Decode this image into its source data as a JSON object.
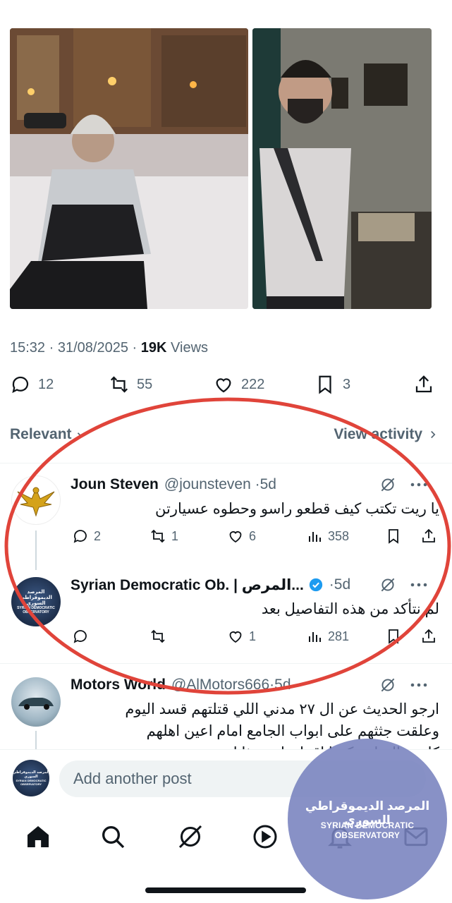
{
  "tweet": {
    "time": "15:32",
    "date": "31/08/2025",
    "dot": "·",
    "views_count": "19K",
    "views_label": "Views",
    "replies": "12",
    "reposts": "55",
    "likes": "222",
    "bookmarks": "3"
  },
  "sort": {
    "relevant_label": "Relevant",
    "view_activity_label": "View activity"
  },
  "replies": [
    {
      "name": "Joun Steven",
      "handle": "@jounsteven",
      "time": "5d",
      "separator": "·",
      "text": "يا ريت تكتب كيف قطعو راسو وحطوه عسيارتن",
      "comments": "2",
      "reposts": "1",
      "likes": "6",
      "views": "358"
    },
    {
      "name": "Syrian Democratic Ob. | المرص...",
      "handle": "",
      "time": "5d",
      "separator": "·",
      "text": "لم نتأكد من هذه التفاصيل بعد",
      "comments": "",
      "reposts": "",
      "likes": "1",
      "views": "281",
      "avatar_text_ar": "المرصد الديموقراطي السوري",
      "avatar_text_en": "SYRIAN DEMOCRATIC OBSERVATORY"
    },
    {
      "name": "Motors World",
      "handle": "@AlMotors666",
      "time": "5d",
      "separator": "·",
      "text_line1": "ارجو الحديث عن ال ٢٧ مدني اللي قتلتهم قسد اليوم",
      "text_line2": "وعلقت جثثهم على ابواب الجامع امام اعين اهلهم",
      "text_line3": "كانت بالسابق كتبنا اقتبان ابن هذا ابن"
    }
  ],
  "compose": {
    "placeholder": "Add another post",
    "avatar_text_ar": "المرصد الديموقراطي السوري",
    "avatar_text_en": "SYRIAN DEMOCRATIC OBSERVATORY"
  },
  "watermark": {
    "arabic": "المرصد الديموقراطي السوري",
    "english": "SYRIAN DEMOCRATIC OBSERVATORY"
  },
  "icons": {
    "reply": "speech-bubble-icon",
    "repost": "repost-icon",
    "like": "heart-icon",
    "bookmark": "bookmark-icon",
    "share": "share-icon",
    "views": "bar-chart-icon",
    "grok": "grok-icon",
    "more": "ellipsis-icon"
  },
  "colors": {
    "secondary_text": "#536471",
    "primary_text": "#0f1419",
    "verified_blue": "#1d9bf0",
    "annotation_red": "#e0443a",
    "watermark": "#7882be"
  }
}
